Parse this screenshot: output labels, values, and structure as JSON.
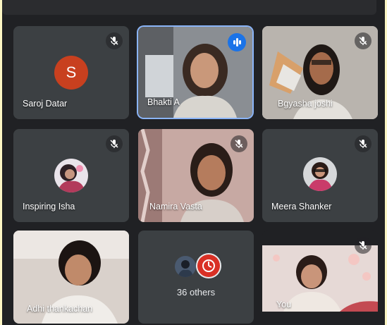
{
  "participants": [
    {
      "name": "Saroj Datar",
      "avatar_letter": "S",
      "muted": true
    },
    {
      "name": "Bhakti A",
      "speaking": true
    },
    {
      "name": "Bgyasha joshi",
      "muted": true
    },
    {
      "name": "Inspiring Isha",
      "muted": true
    },
    {
      "name": "Namira Vasta",
      "muted": true
    },
    {
      "name": "Meera Shanker",
      "muted": true
    },
    {
      "name": "Adhi thankachan",
      "muted": false
    },
    {
      "name": "You",
      "muted": true
    }
  ],
  "others": {
    "label": "36 others"
  },
  "colors": {
    "background": "#202124",
    "tile": "#3c4043",
    "active_outline": "#8ab4f8",
    "avatar_s": "#c8401f",
    "speaking": "#1a73e8",
    "outer_frame": "#fcf6c4"
  },
  "icons": [
    "mic-off-icon",
    "audio-level-icon"
  ]
}
